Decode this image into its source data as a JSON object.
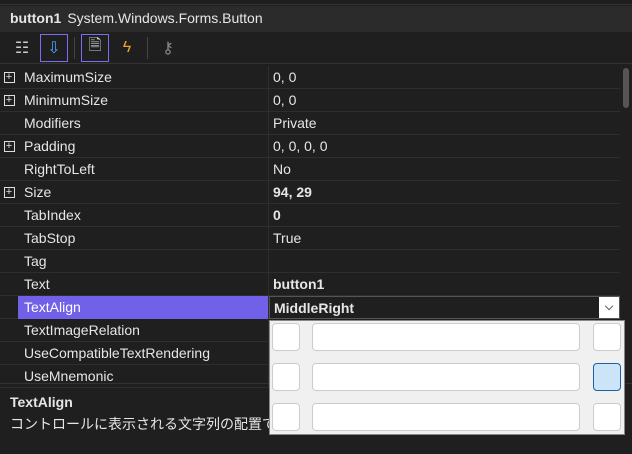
{
  "header": {
    "name": "button1",
    "type": "System.Windows.Forms.Button"
  },
  "toolbar": [
    {
      "icon": "categorized-icon"
    },
    {
      "icon": "alphabetical-icon"
    },
    {
      "icon": "properties-icon"
    },
    {
      "icon": "events-icon"
    },
    {
      "icon": "property-pages-icon"
    }
  ],
  "rows": [
    {
      "name": "MaximumSize",
      "value": "0, 0",
      "expandable": true
    },
    {
      "name": "MinimumSize",
      "value": "0, 0",
      "expandable": true
    },
    {
      "name": "Modifiers",
      "value": "Private"
    },
    {
      "name": "Padding",
      "value": "0, 0, 0, 0",
      "expandable": true
    },
    {
      "name": "RightToLeft",
      "value": "No"
    },
    {
      "name": "Size",
      "value": "94, 29",
      "expandable": true,
      "bold": true
    },
    {
      "name": "TabIndex",
      "value": "0",
      "bold": true
    },
    {
      "name": "TabStop",
      "value": "True"
    },
    {
      "name": "Tag",
      "value": ""
    },
    {
      "name": "Text",
      "value": "button1",
      "bold": true
    },
    {
      "name": "TextAlign",
      "value": "MiddleRight",
      "selected": true
    },
    {
      "name": "TextImageRelation",
      "value": ""
    },
    {
      "name": "UseCompatibleTextRendering",
      "value": ""
    },
    {
      "name": "UseMnemonic",
      "value": ""
    }
  ],
  "align_options": [
    "TopLeft",
    "TopCenter",
    "TopRight",
    "MiddleLeft",
    "MiddleCenter",
    "MiddleRight",
    "BottomLeft",
    "BottomCenter",
    "BottomRight"
  ],
  "selected_align": "MiddleRight",
  "description": {
    "title": "TextAlign",
    "text": "コントロールに表示される文字列の配置です。"
  }
}
